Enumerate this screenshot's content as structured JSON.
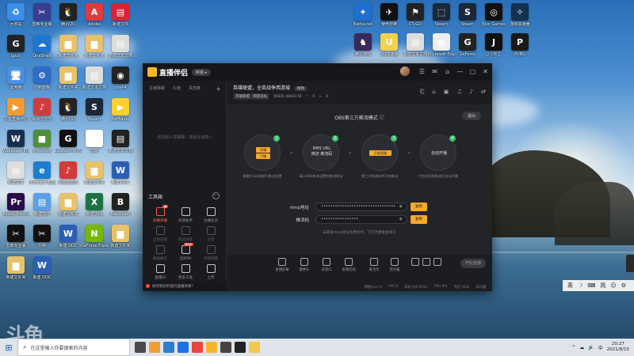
{
  "desktop": {
    "icons_left": [
      {
        "label": "回收站",
        "color": "#3a8ee6",
        "glyph": "♻"
      },
      {
        "label": "剪映专业版",
        "color": "#3b3b8f",
        "glyph": "✂"
      },
      {
        "label": "腾讯QQ",
        "color": "#222",
        "glyph": "🐧"
      },
      {
        "label": "Adobe",
        "color": "#e23b3b",
        "glyph": "A"
      },
      {
        "label": "新建文件",
        "color": "#d23",
        "glyph": "▤"
      },
      {
        "label": "gpuk",
        "color": "#222",
        "glyph": "G"
      },
      {
        "label": "OneDrive",
        "color": "#1f76d2",
        "glyph": "☁"
      },
      {
        "label": "新建文件夹",
        "color": "#e8c26a",
        "glyph": "▆"
      },
      {
        "label": "新建文件夹",
        "color": "#e8c26a",
        "glyph": "▆"
      },
      {
        "label": "新建文本文档",
        "color": "#ddd",
        "glyph": "▤"
      },
      {
        "label": "此电脑",
        "color": "#4a8fe2",
        "glyph": "🖥"
      },
      {
        "label": "控制面板",
        "color": "#2d6cc8",
        "glyph": "⚙"
      },
      {
        "label": "新建文件夹",
        "color": "#e8c26a",
        "glyph": "▆"
      },
      {
        "label": "新建文本文档",
        "color": "#ddd",
        "glyph": "▤"
      },
      {
        "label": "obs64",
        "color": "#222",
        "glyph": "◉"
      },
      {
        "label": "斗鱼直播伴侣",
        "color": "#f29a2c",
        "glyph": "▶"
      },
      {
        "label": "网易云音乐",
        "color": "#d33a3a",
        "glyph": "♪"
      },
      {
        "label": "腾讯QQ",
        "color": "#222",
        "glyph": "🐧"
      },
      {
        "label": "Steam",
        "color": "#1b2838",
        "glyph": "S"
      },
      {
        "label": "PotPlayer",
        "color": "#ffcf2a",
        "glyph": "▶"
      },
      {
        "label": "Wallpaper Engine",
        "color": "#18304f",
        "glyph": "W"
      },
      {
        "label": "Minecraft",
        "color": "#4f8f3a",
        "glyph": "■"
      },
      {
        "label": "Logitech G HUB",
        "color": "#111",
        "glyph": "G"
      },
      {
        "label": "剪映",
        "color": "#fff",
        "glyph": "✂"
      },
      {
        "label": "新建文本文档",
        "color": "#222",
        "glyph": "▤"
      },
      {
        "label": "新建文本",
        "color": "#ddd",
        "glyph": "▤"
      },
      {
        "label": "Microsoft Edge",
        "color": "#1b7fd1",
        "glyph": "e"
      },
      {
        "label": "网易云音乐",
        "color": "#d33a3a",
        "glyph": "♪"
      },
      {
        "label": "新建文件夹",
        "color": "#e8c26a",
        "glyph": "▆"
      },
      {
        "label": "新建 DOC",
        "color": "#2b5fb4",
        "glyph": "W"
      },
      {
        "label": "Adobe Premiere",
        "color": "#2b0c4b",
        "glyph": "Pr"
      },
      {
        "label": "新建文件",
        "color": "#5aa0e6",
        "glyph": "▤"
      },
      {
        "label": "新建文件夹",
        "color": "#e8c26a",
        "glyph": "▆"
      },
      {
        "label": "新建 XLS",
        "color": "#1e7145",
        "glyph": "X"
      },
      {
        "label": "Bandicam",
        "color": "#222",
        "glyph": "B"
      },
      {
        "label": "剪映专业版",
        "color": "#111",
        "glyph": "✂"
      },
      {
        "label": "剪映",
        "color": "#111",
        "glyph": "✂"
      },
      {
        "label": "新建 DOC",
        "color": "#2b5fb4",
        "glyph": "W"
      },
      {
        "label": "GeForce Experience",
        "color": "#76b900",
        "glyph": "N"
      },
      {
        "label": "新建文件夹",
        "color": "#e8c26a",
        "glyph": "▆"
      },
      {
        "label": "新建文件夹",
        "color": "#e8c26a",
        "glyph": "▆"
      },
      {
        "label": "新建 DOC",
        "color": "#2b5fb4",
        "glyph": "W"
      }
    ],
    "icons_right": [
      {
        "label": "Battle.net",
        "color": "#1f6fd1",
        "glyph": "✦"
      },
      {
        "label": "使命召唤",
        "color": "#111",
        "glyph": "✈"
      },
      {
        "label": "CS:GO",
        "color": "#222",
        "glyph": "⚑"
      },
      {
        "label": "Steam",
        "color": "#1b2838",
        "glyph": "⬚"
      },
      {
        "label": "Steam",
        "color": "#1b2838",
        "glyph": "S"
      },
      {
        "label": "Epic Games",
        "color": "#111",
        "glyph": "◎"
      },
      {
        "label": "游戏加速器",
        "color": "#14314f",
        "glyph": "✧"
      },
      {
        "label": "腾讯游戏",
        "color": "#3a2a5a",
        "glyph": "♞"
      },
      {
        "label": "UU加速器",
        "color": "#f5d24a",
        "glyph": "U"
      },
      {
        "label": "新建文本文档",
        "color": "#ddd",
        "glyph": "▤"
      },
      {
        "label": "Microsoft Edge",
        "color": "#eee",
        "glyph": "▦"
      },
      {
        "label": "GeForce",
        "color": "#222",
        "glyph": "G"
      },
      {
        "label": "JJ斗地主",
        "color": "#111",
        "glyph": "J"
      },
      {
        "label": "PUBG",
        "color": "#1a1a1a",
        "glyph": "P"
      }
    ]
  },
  "app": {
    "name": "直播伴侣",
    "version": "新版 ▸",
    "window_controls": [
      "☰",
      "✉",
      "⌂",
      "—",
      "▢",
      "✕"
    ],
    "left_tabs": [
      "主播弹幕",
      "礼物",
      "贵宾席"
    ],
    "left_empty": "还没有人发弹幕，快去互动吧~",
    "tools_heading": "工具箱",
    "tools": [
      {
        "label": "屏幕开播",
        "state": "active",
        "badge": "●"
      },
      {
        "label": "房管助手",
        "state": "normal"
      },
      {
        "label": "主播任务",
        "state": "normal"
      },
      {
        "label": "全民答题",
        "state": "dim"
      },
      {
        "label": "粉丝勋章",
        "state": "dim"
      },
      {
        "label": "分享",
        "state": "dim"
      },
      {
        "label": "数据报告",
        "state": "dim"
      },
      {
        "label": "全民PK",
        "state": "normal",
        "badge": "NEW"
      },
      {
        "label": "开播提醒",
        "state": "dim"
      },
      {
        "label": "直播间",
        "state": "normal"
      },
      {
        "label": "更多工具",
        "state": "normal"
      },
      {
        "label": "上传",
        "state": "normal"
      }
    ],
    "bottom_tip": "如何更好的提升直播效果？",
    "room": {
      "title": "英雄联盟，全英战争西游城",
      "edit": "修改",
      "category": "英雄联盟 · 网游竞技",
      "room_id": "房间号 8883178",
      "fans": "0",
      "hot": "0"
    },
    "header_icons": [
      "⎗",
      "⌂",
      "▣",
      "♫",
      "♪",
      "⇄"
    ],
    "mode_title": "OBS第三方推流模式 ⓘ",
    "exit_label": "退出",
    "steps": [
      {
        "num": "1",
        "lines": [
          "开播",
          "下播"
        ],
        "desc": "需要在obs端进行推流设置"
      },
      {
        "num": "2",
        "lines": [
          "RMS URL",
          "推流 推流码"
        ],
        "desc": "填入OBS推流设置的推流地址"
      },
      {
        "num": "3",
        "lines": [
          "开始直播"
        ],
        "desc": "第三方推流软件开始推流"
      },
      {
        "num": "4",
        "lines": [
          "自动开播"
        ],
        "desc": "平台检测到推流后自动开播"
      }
    ],
    "fields": [
      {
        "label": "rtmp地址",
        "value": "••••••••••••••••••••••••••••••••",
        "copy": "复制"
      },
      {
        "label": "推流码",
        "value": "••••••••••••••••",
        "copy": "复制"
      }
    ],
    "field_note": "未获取rtmp地址有更新时，下次无需重复填写",
    "toolbar": [
      {
        "label": "直播屏幕"
      },
      {
        "label": "摄像头"
      },
      {
        "label": "多窗口"
      },
      {
        "label": "直播连线"
      },
      {
        "label": "麦克风"
      },
      {
        "label": "扬声器"
      }
    ],
    "live_button": "开始直播",
    "status": [
      "网络(ms) 0",
      "FPS 0",
      "丢帧 0(0.00%)",
      "CPU 4%",
      "内存 22%",
      "未开播"
    ]
  },
  "ime": {
    "items": [
      "英",
      "☽",
      "⌨",
      "简",
      "☺",
      "⚙"
    ]
  },
  "watermark": "斗鱼",
  "taskbar": {
    "search_placeholder": "在这里输入你要搜索的内容",
    "apps": [
      "#4a4a4a",
      "#f0a030",
      "#2d7dd2",
      "#1a73e8",
      "#e8453c",
      "#f6b62b",
      "#444",
      "#222",
      "#f2c94c"
    ],
    "tray": [
      "^",
      "☁",
      "🔊",
      "中"
    ],
    "time": "20:27",
    "date": "2021/8/15"
  },
  "colors": {
    "accent": "#f7a928",
    "live_red": "#ff4c3b",
    "step_green": "#3fbf6f"
  }
}
